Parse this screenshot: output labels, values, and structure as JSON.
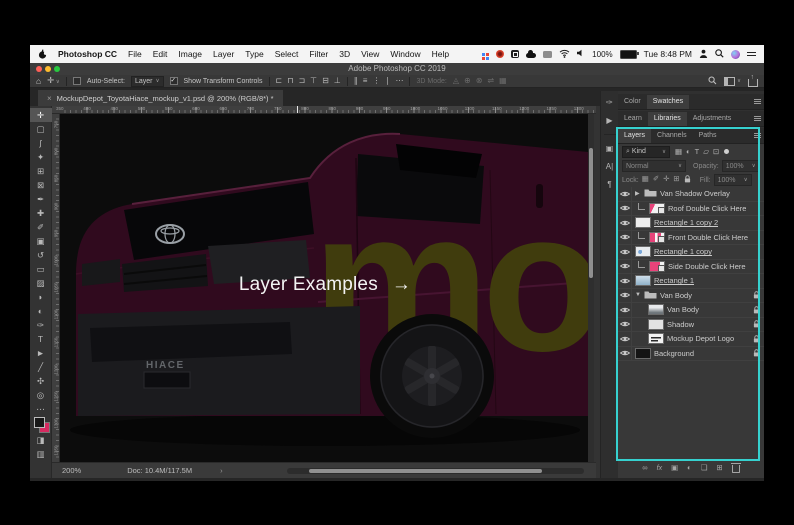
{
  "menubar": {
    "app_name": "Photoshop CC",
    "items": [
      "File",
      "Edit",
      "Image",
      "Layer",
      "Type",
      "Select",
      "Filter",
      "3D",
      "View",
      "Window",
      "Help"
    ],
    "battery_label": "100%",
    "clock": "Tue 8:48 PM"
  },
  "window": {
    "title": "Adobe Photoshop CC 2019"
  },
  "options_bar": {
    "auto_select_label": "Auto-Select:",
    "auto_select_value": "Layer",
    "transform_label": "Show Transform Controls",
    "more_glyph": "⋯",
    "mode_label": "3D Mode:",
    "align_icons": [
      {
        "name": "align-left-icon",
        "g": "⊏"
      },
      {
        "name": "align-center-h-icon",
        "g": "⊓"
      },
      {
        "name": "align-right-icon",
        "g": "⊐"
      },
      {
        "name": "align-top-icon",
        "g": "⊤"
      },
      {
        "name": "align-middle-icon",
        "g": "⊟"
      },
      {
        "name": "align-bottom-icon",
        "g": "⊥"
      }
    ],
    "distribute_icons": [
      {
        "name": "distribute-h-icon",
        "g": "∥"
      },
      {
        "name": "distribute-v-icon",
        "g": "≡"
      },
      {
        "name": "distribute-left-icon",
        "g": "⋮"
      },
      {
        "name": "distribute-top-icon",
        "g": "∣"
      }
    ],
    "mode3d_icons": [
      {
        "name": "3d-rotate-icon",
        "g": "◬"
      },
      {
        "name": "3d-roll-icon",
        "g": "⊕"
      },
      {
        "name": "3d-drag-icon",
        "g": "⊗"
      },
      {
        "name": "3d-slide-icon",
        "g": "⇌"
      },
      {
        "name": "3d-scale-icon",
        "g": "▦"
      }
    ]
  },
  "doc_tab": {
    "close": "×",
    "title": "MockupDepot_ToyotaHiace_mockup_v1.psd @ 200% (RGB/8*) *"
  },
  "tools": [
    {
      "name": "move-tool",
      "g": "✛",
      "selected": true
    },
    {
      "name": "rectangular-marquee-tool",
      "g": "▢"
    },
    {
      "name": "lasso-tool",
      "g": "ʃ"
    },
    {
      "name": "quick-selection-tool",
      "g": "✦"
    },
    {
      "name": "crop-tool",
      "g": "⊞"
    },
    {
      "name": "frame-tool",
      "g": "⊠"
    },
    {
      "name": "eyedropper-tool",
      "g": "✒"
    },
    {
      "name": "spot-healing-tool",
      "g": "✚"
    },
    {
      "name": "brush-tool",
      "g": "✐"
    },
    {
      "name": "clone-stamp-tool",
      "g": "▣"
    },
    {
      "name": "history-brush-tool",
      "g": "↺"
    },
    {
      "name": "eraser-tool",
      "g": "▭"
    },
    {
      "name": "gradient-tool",
      "g": "▨"
    },
    {
      "name": "blur-tool",
      "g": "◗"
    },
    {
      "name": "dodge-tool",
      "g": "◐"
    },
    {
      "name": "pen-tool",
      "g": "✑"
    },
    {
      "name": "type-tool",
      "g": "T"
    },
    {
      "name": "path-selection-tool",
      "g": "►"
    },
    {
      "name": "line-tool",
      "g": "╱"
    },
    {
      "name": "hand-tool",
      "g": "✣"
    },
    {
      "name": "zoom-tool",
      "g": "◎"
    },
    {
      "name": "edit-toolbar",
      "g": "⋯"
    },
    {
      "name": "color-swatches",
      "swatches": true
    },
    {
      "name": "quick-mask-button",
      "g": "◨"
    },
    {
      "name": "screen-mode-button",
      "g": "▥"
    }
  ],
  "rulers": {
    "top": [
      "350",
      "400",
      "450",
      "500",
      "550",
      "600",
      "650",
      "700",
      "750",
      "800",
      "850",
      "900",
      "950",
      "1000",
      "1050",
      "1100",
      "1150",
      "1200",
      "1250",
      "1300",
      "1350"
    ],
    "left": [
      "750",
      "800",
      "850",
      "900",
      "950",
      "1000",
      "1050",
      "1100",
      "1150",
      "1200",
      "1250",
      "1300",
      "1350"
    ]
  },
  "canvas": {
    "annotation": "Layer Examples",
    "arrow": "→",
    "badge": "HIACE",
    "brand_letters": "mo"
  },
  "status_bar": {
    "zoom": "200%",
    "doc_info": "Doc: 10.4M/117.5M",
    "chevron": "›"
  },
  "dock_icons": [
    {
      "name": "brushes-panel-icon",
      "g": "✑"
    },
    {
      "name": "actions-panel-icon",
      "g": "▶"
    },
    {
      "name": "clone-source-panel-icon",
      "g": "▣"
    },
    {
      "name": "character-panel-icon",
      "g": "A|"
    },
    {
      "name": "paragraph-panel-icon",
      "g": "¶"
    }
  ],
  "panels": {
    "group1": {
      "tabs": [
        "Color",
        "Swatches"
      ],
      "active": "Swatches"
    },
    "group2": {
      "tabs": [
        "Learn",
        "Libraries",
        "Adjustments"
      ],
      "active": "Libraries"
    },
    "layers": {
      "tabs": [
        "Layers",
        "Channels",
        "Paths"
      ],
      "active": "Layers",
      "filter_label": "Kind",
      "filter_icons": [
        {
          "name": "filter-pixel-icon",
          "g": "▦"
        },
        {
          "name": "filter-adjustment-icon",
          "g": "◐"
        },
        {
          "name": "filter-type-icon",
          "g": "T"
        },
        {
          "name": "filter-shape-icon",
          "g": "▱"
        },
        {
          "name": "filter-smart-object-icon",
          "g": "⊡"
        }
      ],
      "blend_mode": "Normal",
      "opacity_label": "Opacity:",
      "opacity_value": "100%",
      "lock_label": "Lock:",
      "lock_icons": [
        {
          "name": "lock-transparent-icon",
          "g": "▦"
        },
        {
          "name": "lock-pixels-icon",
          "g": "✐"
        },
        {
          "name": "lock-position-icon",
          "g": "✛"
        },
        {
          "name": "lock-artboard-icon",
          "g": "⊞"
        },
        {
          "name": "lock-all-icon",
          "g": "lock"
        }
      ],
      "fill_label": "Fill:",
      "fill_value": "100%",
      "rows": [
        {
          "name": "Van Shadow Overlay",
          "type": "group",
          "arrow": "collapsed",
          "locked": false
        },
        {
          "name": "Roof Double Click Here",
          "type": "smart",
          "clipped": true,
          "thumb": "roof"
        },
        {
          "name": "Rectangle 1 copy 2",
          "type": "shape",
          "underlined": true,
          "thumb": "white"
        },
        {
          "name": "Front Double Click Here",
          "type": "smart",
          "clipped": true,
          "thumb": "front"
        },
        {
          "name": "Rectangle 1 copy",
          "type": "shape",
          "underlined": true,
          "thumb": "white_blue"
        },
        {
          "name": "Side Double Click Here",
          "type": "smart",
          "clipped": true,
          "thumb": "side"
        },
        {
          "name": "Rectangle 1",
          "type": "shape",
          "underlined": true,
          "thumb": "van_blue"
        },
        {
          "name": "Van Body",
          "type": "group",
          "arrow": "expanded",
          "locked": true
        },
        {
          "name": "Van Body",
          "type": "layer",
          "child": true,
          "locked": true,
          "thumb": "van_gray"
        },
        {
          "name": "Shadow",
          "type": "layer",
          "child": true,
          "locked": true,
          "thumb": "shadow"
        },
        {
          "name": "Mockup Depot Logo",
          "type": "layer",
          "child": true,
          "locked": true,
          "thumb": "logo"
        },
        {
          "name": "Background",
          "type": "layer",
          "locked": true,
          "thumb": "black"
        }
      ],
      "footer_icons": [
        {
          "name": "link-layers-icon",
          "g": "∞"
        },
        {
          "name": "layer-effects-icon",
          "g": "fx"
        },
        {
          "name": "layer-mask-icon",
          "g": "▣"
        },
        {
          "name": "adjustment-layer-icon",
          "g": "◐"
        },
        {
          "name": "new-group-icon",
          "g": "❏"
        },
        {
          "name": "new-layer-icon",
          "g": "⊞"
        },
        {
          "name": "delete-layer-icon",
          "g": "trash"
        }
      ]
    }
  },
  "colors": {
    "accent": "#36d1cf",
    "canvas_bg": "#0c0c0c",
    "van_body": "#300a1e",
    "brand_olive": "#403c0d",
    "swatch_fg": "#181818",
    "swatch_bg": "#d62a60"
  }
}
